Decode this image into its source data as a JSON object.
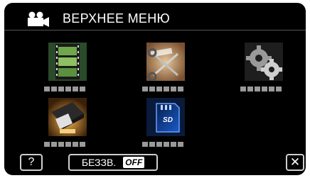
{
  "header": {
    "title": "ВЕРХНЕЕ МЕНЮ",
    "icon": "video-camera-icon"
  },
  "menu_items": [
    {
      "name": "video-menu",
      "icon": "film-strip-icon",
      "colors": [
        "#3a6a3a",
        "#9bc47a"
      ]
    },
    {
      "name": "edit-menu",
      "icon": "scissors-icon",
      "colors": [
        "#6a4a2a",
        "#d8b48a"
      ]
    },
    {
      "name": "settings-menu",
      "icon": "gears-icon",
      "colors": [
        "#404040",
        "#b0b0b0"
      ]
    },
    {
      "name": "connection-menu",
      "icon": "usb-plug-icon",
      "colors": [
        "#5a3a10",
        "#e0a040"
      ]
    },
    {
      "name": "media-menu",
      "icon": "sd-card-icon",
      "colors": [
        "#0a2a6a",
        "#3a7ae0"
      ]
    }
  ],
  "footer": {
    "help_label": "?",
    "mute_label": "БЕЗЗВ.",
    "mute_state": "OFF",
    "close_label": "✕"
  }
}
